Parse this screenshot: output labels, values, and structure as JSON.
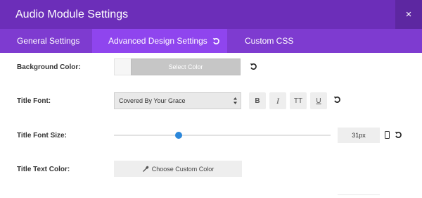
{
  "window": {
    "title": "Audio Module Settings",
    "close_icon": "×"
  },
  "tabs": [
    {
      "label": "General Settings",
      "active": false
    },
    {
      "label": "Advanced Design Settings",
      "active": true
    },
    {
      "label": "Custom CSS",
      "active": false
    }
  ],
  "fields": {
    "background_color": {
      "label": "Background Color:",
      "button_label": "Select Color",
      "swatch": "#f6f6f6"
    },
    "title_font": {
      "label": "Title Font:",
      "value": "Covered By Your Grace",
      "styles": [
        "B",
        "I",
        "TT",
        "U"
      ]
    },
    "title_font_size": {
      "label": "Title Font Size:",
      "value": "31px",
      "slider_fraction": 0.3
    },
    "title_text_color": {
      "label": "Title Text Color:",
      "button_label": "Choose Custom Color"
    }
  },
  "colors": {
    "header": "#6c2eb9",
    "tabs": "#7e3bd0",
    "active_tab": "#8f45ee",
    "slider_thumb": "#2b87da"
  },
  "icons": [
    "reset-icon",
    "close-icon",
    "mobile-icon",
    "eyedropper-icon",
    "select-arrows-icon"
  ]
}
